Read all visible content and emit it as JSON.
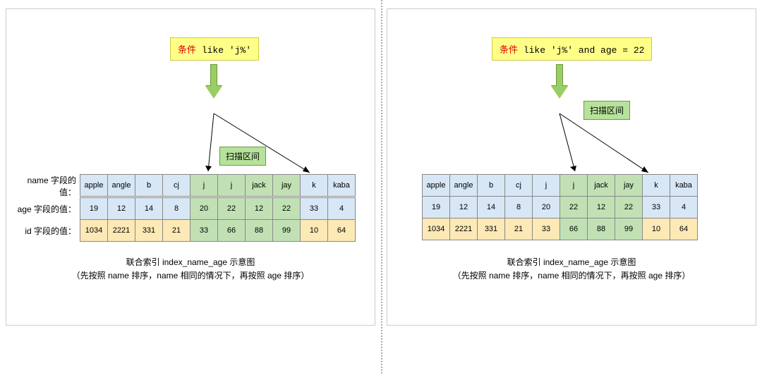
{
  "left": {
    "condition_prefix": "条件",
    "condition_sql": "like 'j%'",
    "scan_label": "扫描区间",
    "row_labels": {
      "name": "name 字段的值：",
      "age": "age 字段的值：",
      "id": "id 字段的值："
    },
    "columns": [
      {
        "name": "apple",
        "age": "19",
        "id": "1034",
        "hl": false
      },
      {
        "name": "angle",
        "age": "12",
        "id": "2221",
        "hl": false
      },
      {
        "name": "b",
        "age": "14",
        "id": "331",
        "hl": false
      },
      {
        "name": "cj",
        "age": "8",
        "id": "21",
        "hl": false
      },
      {
        "name": "j",
        "age": "20",
        "id": "33",
        "hl": true
      },
      {
        "name": "j",
        "age": "22",
        "id": "66",
        "hl": true
      },
      {
        "name": "jack",
        "age": "12",
        "id": "88",
        "hl": true
      },
      {
        "name": "jay",
        "age": "22",
        "id": "99",
        "hl": true
      },
      {
        "name": "k",
        "age": "33",
        "id": "10",
        "hl": false
      },
      {
        "name": "kaba",
        "age": "4",
        "id": "64",
        "hl": false
      }
    ],
    "caption_l1": "联合索引 index_name_age 示意图",
    "caption_l2": "（先按照 name 排序，name 相同的情况下，再按照 age 排序）"
  },
  "right": {
    "condition_prefix": "条件",
    "condition_sql": "like 'j%' and age = 22",
    "scan_label": "扫描区间",
    "row_labels": {
      "name": "",
      "age": "",
      "id": ""
    },
    "columns": [
      {
        "name": "apple",
        "age": "19",
        "id": "1034",
        "hl": false
      },
      {
        "name": "angle",
        "age": "12",
        "id": "2221",
        "hl": false
      },
      {
        "name": "b",
        "age": "14",
        "id": "331",
        "hl": false
      },
      {
        "name": "cj",
        "age": "8",
        "id": "21",
        "hl": false
      },
      {
        "name": "j",
        "age": "20",
        "id": "33",
        "hl": false
      },
      {
        "name": "j",
        "age": "22",
        "id": "66",
        "hl": true
      },
      {
        "name": "jack",
        "age": "12",
        "id": "88",
        "hl": true
      },
      {
        "name": "jay",
        "age": "22",
        "id": "99",
        "hl": true
      },
      {
        "name": "k",
        "age": "33",
        "id": "10",
        "hl": false
      },
      {
        "name": "kaba",
        "age": "4",
        "id": "64",
        "hl": false
      }
    ],
    "caption_l1": "联合索引 index_name_age 示意图",
    "caption_l2": "（先按照 name 排序，name 相同的情况下，再按照 age 排序）"
  }
}
